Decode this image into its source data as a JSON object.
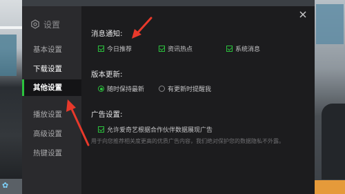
{
  "dialog": {
    "title": "设置",
    "close_icon": "close-icon"
  },
  "sidebar": {
    "items": [
      {
        "label": "基本设置"
      },
      {
        "label": "下载设置"
      },
      {
        "label": "其他设置"
      },
      {
        "label": "播放设置"
      },
      {
        "label": "高级设置"
      },
      {
        "label": "热键设置"
      }
    ],
    "active_index": 2
  },
  "notifications": {
    "title": "消息通知:",
    "options": [
      {
        "label": "今日推荐",
        "checked": true
      },
      {
        "label": "资讯热点",
        "checked": true
      },
      {
        "label": "系统消息",
        "checked": true
      }
    ]
  },
  "update": {
    "title": "版本更新:",
    "options": [
      {
        "label": "随时保持最新",
        "selected": true
      },
      {
        "label": "有更新时提醒我",
        "selected": false
      }
    ]
  },
  "ads": {
    "title": "广告设置:",
    "option": {
      "label": "允许爱奇艺根据合作伙伴数据展现广告",
      "checked": true
    },
    "note": "用于向您推荐相关度更高的优质广告内容，我们绝对保护您的数据隐私不外露。"
  },
  "colors": {
    "accent": "#2bc33d",
    "arrow": "#e8392b",
    "panel": "#1c1c1e",
    "sidebar": "#2a2a2d"
  }
}
